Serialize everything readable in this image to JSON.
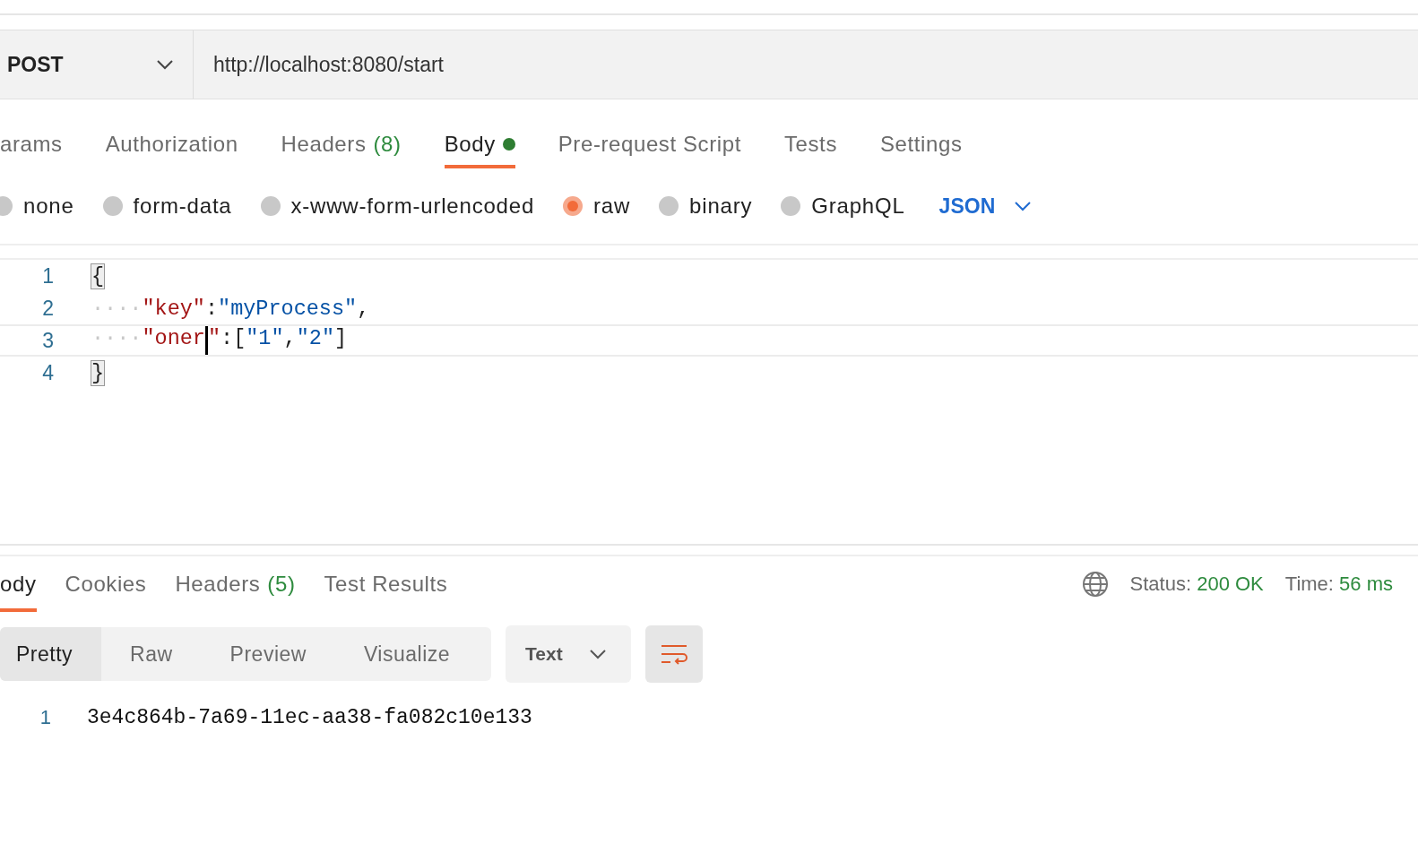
{
  "request": {
    "method": "POST",
    "url": "http://localhost:8080/start"
  },
  "request_tabs": [
    {
      "label": "arams",
      "selected": false
    },
    {
      "label": "Authorization",
      "selected": false
    },
    {
      "label": "Headers",
      "count": "(8)",
      "selected": false
    },
    {
      "label": "Body",
      "selected": true,
      "dot": true
    },
    {
      "label": "Pre-request Script",
      "selected": false
    },
    {
      "label": "Tests",
      "selected": false
    },
    {
      "label": "Settings",
      "selected": false
    }
  ],
  "body_types": [
    {
      "label": "none",
      "selected": false
    },
    {
      "label": "form-data",
      "selected": false
    },
    {
      "label": "x-www-form-urlencoded",
      "selected": false
    },
    {
      "label": "raw",
      "selected": true
    },
    {
      "label": "binary",
      "selected": false
    },
    {
      "label": "GraphQL",
      "selected": false
    }
  ],
  "format": "JSON",
  "editor_lines": [
    {
      "number": "1",
      "current": false,
      "tokens": [
        {
          "kind": "brace",
          "text": "{",
          "matched": true
        }
      ]
    },
    {
      "number": "2",
      "current": false,
      "tokens": [
        {
          "kind": "ws",
          "text": "····"
        },
        {
          "kind": "key",
          "text": "\"key\""
        },
        {
          "kind": "punct",
          "text": ":"
        },
        {
          "kind": "string",
          "text": "\"myProcess\""
        },
        {
          "kind": "punct",
          "text": ","
        }
      ]
    },
    {
      "number": "3",
      "current": true,
      "tokens": [
        {
          "kind": "ws",
          "text": "····"
        },
        {
          "kind": "key",
          "text": "\"oner"
        },
        {
          "kind": "cursor"
        },
        {
          "kind": "key",
          "text": "\""
        },
        {
          "kind": "punct",
          "text": ":["
        },
        {
          "kind": "string",
          "text": "\"1\""
        },
        {
          "kind": "punct",
          "text": ","
        },
        {
          "kind": "string",
          "text": "\"2\""
        },
        {
          "kind": "punct",
          "text": "]"
        }
      ]
    },
    {
      "number": "4",
      "current": false,
      "tokens": [
        {
          "kind": "brace",
          "text": "}",
          "matched": true
        }
      ]
    }
  ],
  "response_tabs": [
    {
      "label": "ody",
      "selected": true
    },
    {
      "label": "Cookies",
      "selected": false
    },
    {
      "label": "Headers",
      "count": "(5)",
      "selected": false
    },
    {
      "label": "Test Results",
      "selected": false
    }
  ],
  "status": {
    "label": "Status:",
    "value": "200 OK",
    "time_label": "Time:",
    "time_value": "56 ms"
  },
  "view_modes": [
    {
      "label": "Pretty",
      "selected": true
    },
    {
      "label": "Raw",
      "selected": false
    },
    {
      "label": "Preview",
      "selected": false
    },
    {
      "label": "Visualize",
      "selected": false
    }
  ],
  "response_format": "Text",
  "wrap_active": true,
  "response_lines": [
    {
      "number": "1",
      "text": "3e4c864b-7a69-11ec-aa38-fa082c10e133"
    }
  ]
}
